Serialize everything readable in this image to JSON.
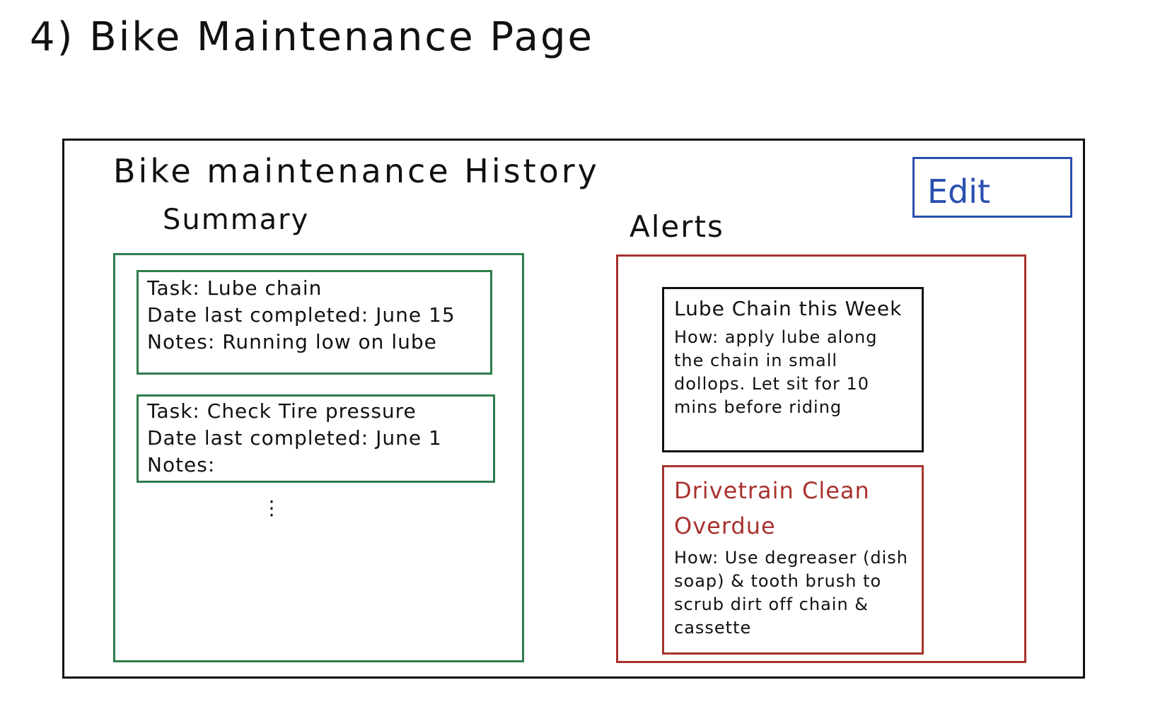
{
  "page_heading": "4) Bike Maintenance Page",
  "history_title": "Bike maintenance History",
  "edit_label": "Edit",
  "summary": {
    "heading": "Summary",
    "tasks": [
      {
        "task": "Task: Lube chain",
        "date": "Date last completed: June 15",
        "notes": "Notes: Running low on lube"
      },
      {
        "task": "Task: Check Tire pressure",
        "date": "Date last completed: June 1",
        "notes": "Notes:"
      }
    ],
    "more": "⋮"
  },
  "alerts": {
    "heading": "Alerts",
    "items": [
      {
        "title": "Lube Chain this Week",
        "body": "How: apply lube along the chain in small dollops. Let sit for 10 mins before riding"
      },
      {
        "title": "Drivetrain Clean Overdue",
        "body": "How: Use degreaser (dish soap) & tooth brush to scrub dirt off chain & cassette"
      }
    ]
  },
  "colors": {
    "edit": "#2a4fb0",
    "summary": "#2e7d4a",
    "alerts": "#a8322e",
    "frame": "#111111"
  }
}
